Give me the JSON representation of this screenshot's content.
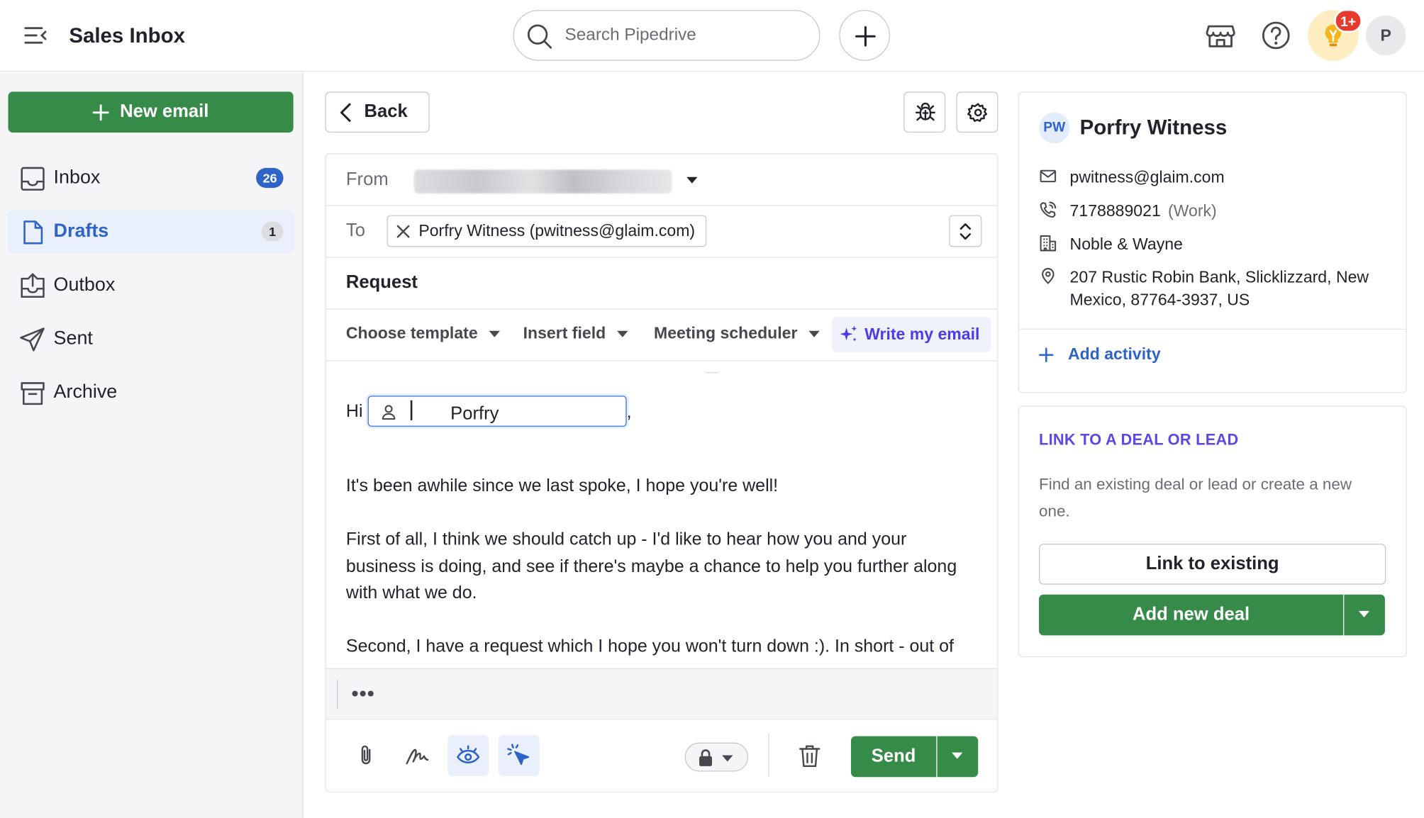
{
  "app": {
    "title": "Sales Inbox"
  },
  "search": {
    "placeholder": "Search Pipedrive"
  },
  "topbar": {
    "notification_badge": "1+",
    "avatar_initial": "P",
    "icons": [
      "menu-collapse-icon",
      "search-icon",
      "plus-icon",
      "marketplace-icon",
      "help-icon",
      "growth-bulb-icon"
    ]
  },
  "sidebar": {
    "new_email_label": "New email",
    "items": [
      {
        "label": "Inbox",
        "count": "26",
        "icon": "inbox-icon"
      },
      {
        "label": "Drafts",
        "count": "1",
        "icon": "draft-icon",
        "active": true
      },
      {
        "label": "Outbox",
        "icon": "outbox-icon"
      },
      {
        "label": "Sent",
        "icon": "send-icon"
      },
      {
        "label": "Archive",
        "icon": "archive-icon"
      }
    ]
  },
  "composer": {
    "back_label": "Back",
    "from_label": "From",
    "to_label": "To",
    "recipient": "Porfry Witness (pwitness@glaim.com)",
    "subject": "Request",
    "toolbar": {
      "template": "Choose template",
      "insert_field": "Insert field",
      "meeting": "Meeting scheduler",
      "ai": "Write my email"
    },
    "greeting": "Hi",
    "name_value": "Porfry",
    "comma": ",",
    "paragraphs": [
      "It's been awhile since we last spoke, I hope you're well!",
      "First of all, I think we should catch up - I'd like to hear how you and your business is doing, and see if there's maybe a chance to help you further along with what we do.",
      "Second, I have a request which I hope you won't turn down :). In short - out of"
    ],
    "more_label": "•••",
    "send_label": "Send"
  },
  "contact": {
    "initials": "PW",
    "name": "Porfry Witness",
    "email": "pwitness@glaim.com",
    "phone": "7178889021",
    "phone_type": "(Work)",
    "organization": "Noble & Wayne",
    "address": "207 Rustic Robin Bank, Slicklizzard, New Mexico, 87764-3937, US",
    "add_activity": "Add activity"
  },
  "link_panel": {
    "title": "LINK TO A DEAL OR LEAD",
    "description": "Find an existing deal or lead or create a new one.",
    "link_existing": "Link to existing",
    "add_new_deal": "Add new deal"
  },
  "colors": {
    "primary_green": "#378b48",
    "link_blue": "#2e63c7",
    "ai_purple": "#4b3ce8",
    "badge_red": "#e8392d"
  }
}
